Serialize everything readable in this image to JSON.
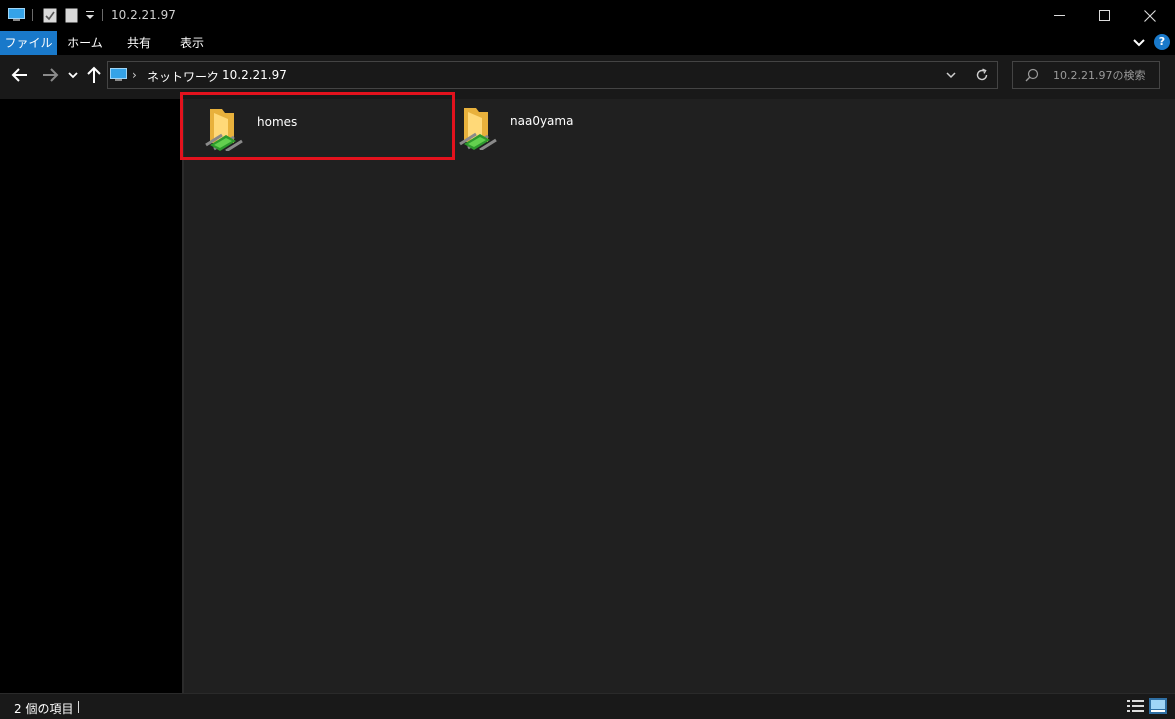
{
  "window": {
    "title": "10.2.21.97"
  },
  "ribbon": {
    "tabs": [
      {
        "label": "ファイル",
        "active": true
      },
      {
        "label": "ホーム"
      },
      {
        "label": "共有"
      },
      {
        "label": "表示"
      }
    ],
    "help_label": "?"
  },
  "address_bar": {
    "breadcrumbs": [
      "ネットワーク",
      "10.2.21.97"
    ],
    "separator": "›"
  },
  "search": {
    "placeholder": "10.2.21.97の検索"
  },
  "items": [
    {
      "name": "homes",
      "icon": "network-shared-folder-icon",
      "highlighted": true
    },
    {
      "name": "naa0yama",
      "icon": "network-shared-folder-icon",
      "highlighted": false
    }
  ],
  "status_bar": {
    "item_count": "2 個の項目"
  },
  "colors": {
    "accent": "#1979ca",
    "highlight_box": "#e3121d",
    "content_bg": "#202020",
    "nav_pane_bg": "#000000"
  }
}
